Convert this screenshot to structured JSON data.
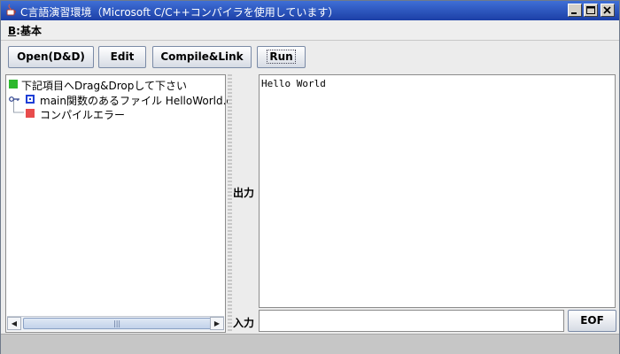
{
  "window": {
    "title": "C言語演習環境（Microsoft C/C++コンパイラを使用しています）"
  },
  "menubar": {
    "menu_mnemonic": "B",
    "menu_label": ":基本"
  },
  "toolbar": {
    "open_label": "Open(D&D)",
    "edit_label": "Edit",
    "compile_label": "Compile&Link",
    "run_label": "Run"
  },
  "tree": {
    "items": [
      {
        "label": "下記項目へDrag&Dropして下さい",
        "icon": "green-square-icon",
        "color": "#2db82d"
      },
      {
        "label": "main関数のあるファイル  HelloWorld.c",
        "icon": "blue-box-icon",
        "color": "#1f3fd6"
      },
      {
        "label": "コンパイルエラー",
        "icon": "red-square-icon",
        "color": "#e84c4c"
      }
    ]
  },
  "scrollbar": {
    "left_arrow": "◀",
    "right_arrow": "▶",
    "grip": "|||"
  },
  "output": {
    "label": "出力",
    "text": "Hello World"
  },
  "input": {
    "label": "入力",
    "value": "",
    "eof_label": "EOF"
  }
}
